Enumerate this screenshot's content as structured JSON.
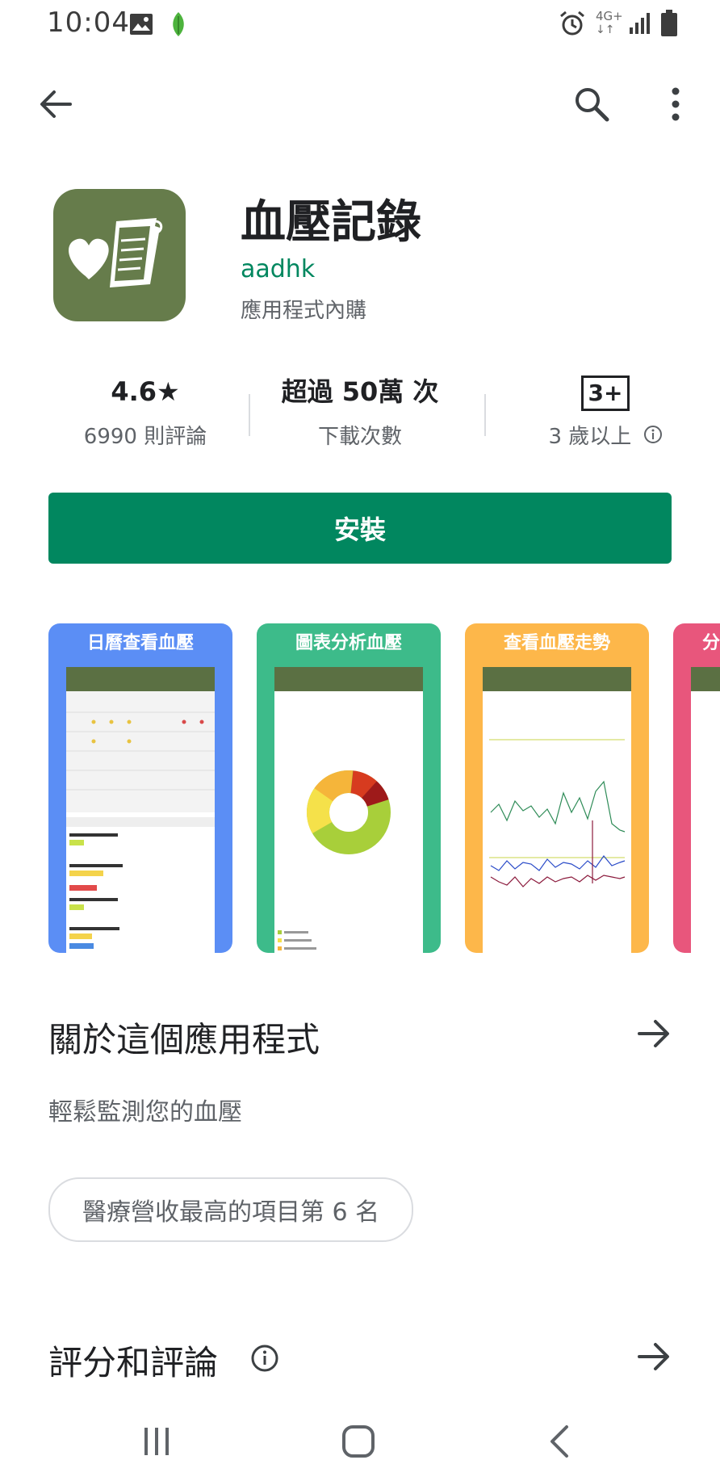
{
  "status": {
    "time": "10:04",
    "network": "4G+",
    "icons": [
      "image-icon",
      "leaf-icon",
      "alarm-icon",
      "network-icon",
      "signal-icon",
      "battery-icon"
    ]
  },
  "toolbar": {
    "back_icon": "back-arrow-icon",
    "search_icon": "search-icon",
    "more_icon": "more-vert-icon"
  },
  "app": {
    "title": "血壓記錄",
    "developer": "aadhk",
    "iap": "應用程式內購",
    "icon_color": "#667c4b"
  },
  "stats": {
    "rating": "4.6",
    "rating_star": "★",
    "reviews": "6990 則評論",
    "downloads": "超過 50萬 次",
    "downloads_label": "下載次數",
    "age_badge": "3+",
    "age_label": "3 歲以上"
  },
  "install": {
    "label": "安裝",
    "color": "#01875f"
  },
  "screenshots": [
    {
      "title": "日曆查看血壓",
      "color": "#5b8ef5"
    },
    {
      "title": "圖表分析血壓",
      "color": "#3dbb8a"
    },
    {
      "title": "查看血壓走勢",
      "color": "#fdb74a"
    },
    {
      "title": "分",
      "color": "#e8567c"
    }
  ],
  "about": {
    "title": "關於這個應用程式",
    "description": "輕鬆監測您的血壓",
    "rank_chip": "醫療營收最高的項目第 6 名"
  },
  "ratings_section": {
    "title": "評分和評論"
  },
  "navbar": {
    "recents_icon": "recents-icon",
    "home_icon": "home-icon",
    "back_icon": "nav-back-icon"
  }
}
